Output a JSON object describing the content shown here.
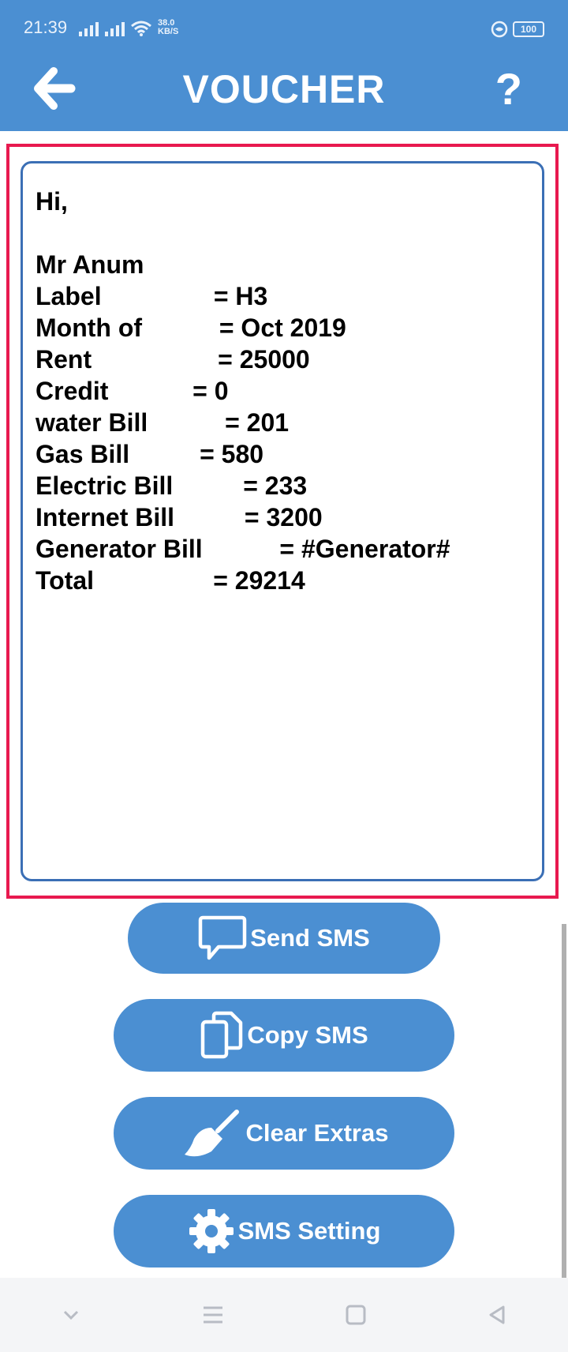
{
  "status_bar": {
    "time": "21:39",
    "net_speed_value": "38.0",
    "net_speed_unit": "KB/S",
    "battery": "100"
  },
  "app_bar": {
    "title": "VOUCHER",
    "back_icon": "back-arrow-icon",
    "help_label": "?"
  },
  "message": {
    "lines": [
      {
        "key": "Hi,",
        "value": ""
      },
      {
        "key": "",
        "value": ""
      },
      {
        "key": "Mr Anum",
        "value": ""
      },
      {
        "key": "Label                ",
        "value": "= H3"
      },
      {
        "key": "Month of           ",
        "value": "= Oct 2019"
      },
      {
        "key": "Rent                  ",
        "value": "= 25000"
      },
      {
        "key": "Credit            ",
        "value": "= 0"
      },
      {
        "key": "water Bill           ",
        "value": "= 201"
      },
      {
        "key": "Gas Bill          ",
        "value": "= 580"
      },
      {
        "key": "Electric Bill          ",
        "value": "= 233"
      },
      {
        "key": "Internet Bill          ",
        "value": "= 3200"
      },
      {
        "key": "Generator Bill           ",
        "value": "= #Generator#"
      },
      {
        "key": "Total                 ",
        "value": "= 29214"
      }
    ]
  },
  "buttons": {
    "send_sms": "Send SMS",
    "copy_sms": "Copy SMS",
    "clear_extras": "Clear Extras",
    "sms_setting": "SMS Setting"
  },
  "colors": {
    "primary": "#4b8fd2",
    "highlight_border": "#e8194f",
    "card_border": "#3b6fb5"
  }
}
